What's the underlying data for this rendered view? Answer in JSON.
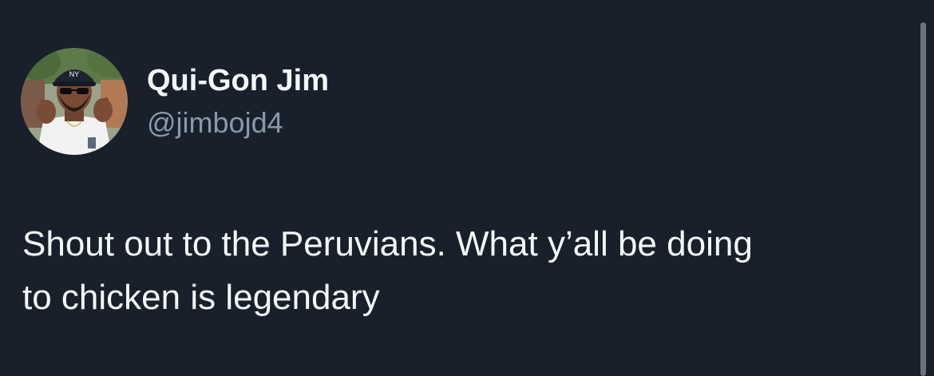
{
  "tweet": {
    "author": {
      "display_name": "Qui-Gon Jim",
      "handle": "@jimbojd4",
      "avatar_icon": "profile-photo"
    },
    "text_lines": [
      "Shout out to the Peruvians. What y’all be doing",
      "to chicken is legendary"
    ]
  },
  "colors": {
    "background": "#17202b",
    "primary_text": "#f5f8fa",
    "secondary_text": "#8b98a5"
  }
}
